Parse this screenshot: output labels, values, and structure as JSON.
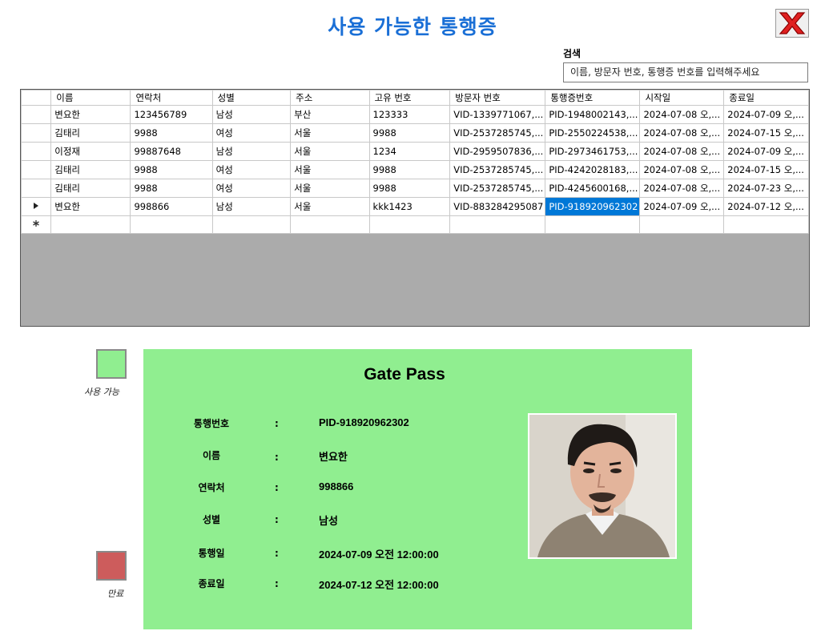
{
  "header": {
    "title": "사용 가능한 통행증"
  },
  "search": {
    "label": "검색",
    "placeholder": "이름, 방문자 번호, 통행증 번호를 입력해주세요"
  },
  "grid": {
    "columns": [
      "이름",
      "연락처",
      "성별",
      "주소",
      "고유 번호",
      "방문자 번호",
      "통행증번호",
      "시작일",
      "종료일"
    ],
    "rows": [
      [
        "변요한",
        "123456789",
        "남성",
        "부산",
        "123333",
        "VID-1339771067,...",
        "PID-1948002143,...",
        "2024-07-08 오,...",
        "2024-07-09 오,..."
      ],
      [
        "김태리",
        "9988",
        "여성",
        "서울",
        "9988",
        "VID-2537285745,...",
        "PID-2550224538,...",
        "2024-07-08 오,...",
        "2024-07-15 오,..."
      ],
      [
        "이정재",
        "99887648",
        "남성",
        "서울",
        "1234",
        "VID-2959507836,...",
        "PID-2973461753,...",
        "2024-07-08 오,...",
        "2024-07-09 오,..."
      ],
      [
        "김태리",
        "9988",
        "여성",
        "서울",
        "9988",
        "VID-2537285745,...",
        "PID-4242028183,...",
        "2024-07-08 오,...",
        "2024-07-15 오,..."
      ],
      [
        "김태리",
        "9988",
        "여성",
        "서울",
        "9988",
        "VID-2537285745,...",
        "PID-4245600168,...",
        "2024-07-08 오,...",
        "2024-07-23 오,..."
      ],
      [
        "변요한",
        "998866",
        "남성",
        "서울",
        "kkk1423",
        "VID-883284295087",
        "PID-918920962302",
        "2024-07-09 오,...",
        "2024-07-12 오,..."
      ]
    ],
    "selected_row": 5,
    "selected_col": 6
  },
  "legend": {
    "available_label": "사용 가능",
    "available_color": "#90ee90",
    "expired_label": "만료",
    "expired_color": "#cd5c5c"
  },
  "pass": {
    "title": "Gate Pass",
    "colon": ":",
    "fields": [
      {
        "label": "통행번호",
        "value": "PID-918920962302"
      },
      {
        "label": "이름",
        "value": "변요한"
      },
      {
        "label": "연락처",
        "value": "998866"
      },
      {
        "label": "성별",
        "value": "남성"
      },
      {
        "label": "통행일",
        "value": "2024-07-09 오전 12:00:00"
      },
      {
        "label": "종료일",
        "value": "2024-07-12 오전 12:00:00"
      }
    ],
    "bg_color": "#90ee90"
  }
}
